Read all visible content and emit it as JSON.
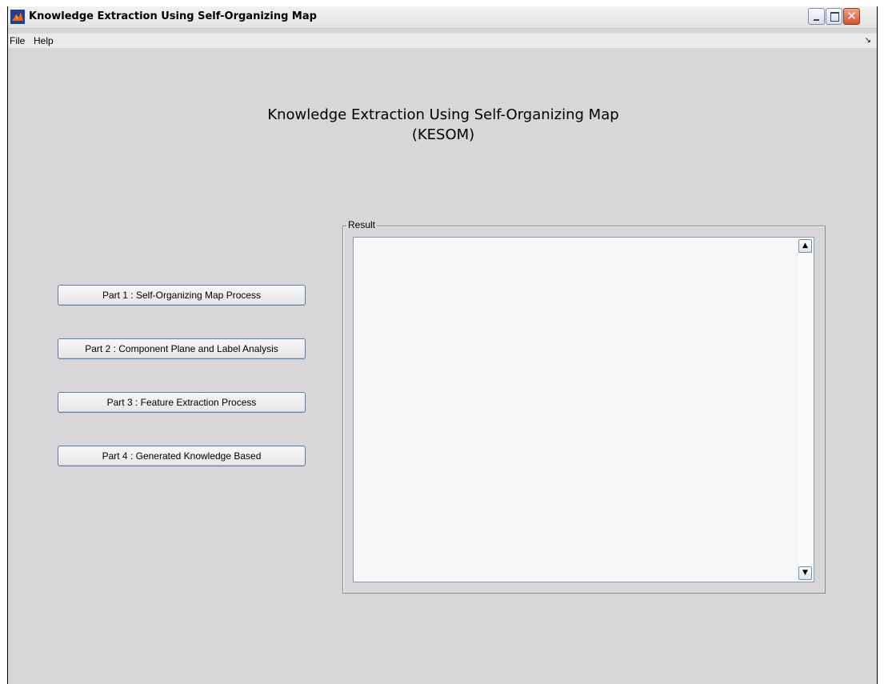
{
  "window": {
    "title": "Knowledge Extraction Using Self-Organizing Map",
    "close_glyph": "✕"
  },
  "menu": {
    "items": [
      "File",
      "Help"
    ],
    "dock_glyph": "↘"
  },
  "heading": {
    "line1": "Knowledge Extraction Using Self-Organizing Map",
    "line2": "(KESOM)"
  },
  "buttons": [
    "Part 1 : Self-Organizing Map Process",
    "Part 2 : Component Plane and Label Analysis",
    "Part 3 : Feature Extraction Process",
    "Part 4 : Generated Knowledge Based"
  ],
  "result": {
    "label": "Result",
    "text": "",
    "scroll_up_glyph": "▲",
    "scroll_down_glyph": "▼"
  },
  "colors": {
    "window_bg": "#d8d6d8",
    "button_border": "#5a7fa6",
    "close_button": "#d8502f"
  }
}
